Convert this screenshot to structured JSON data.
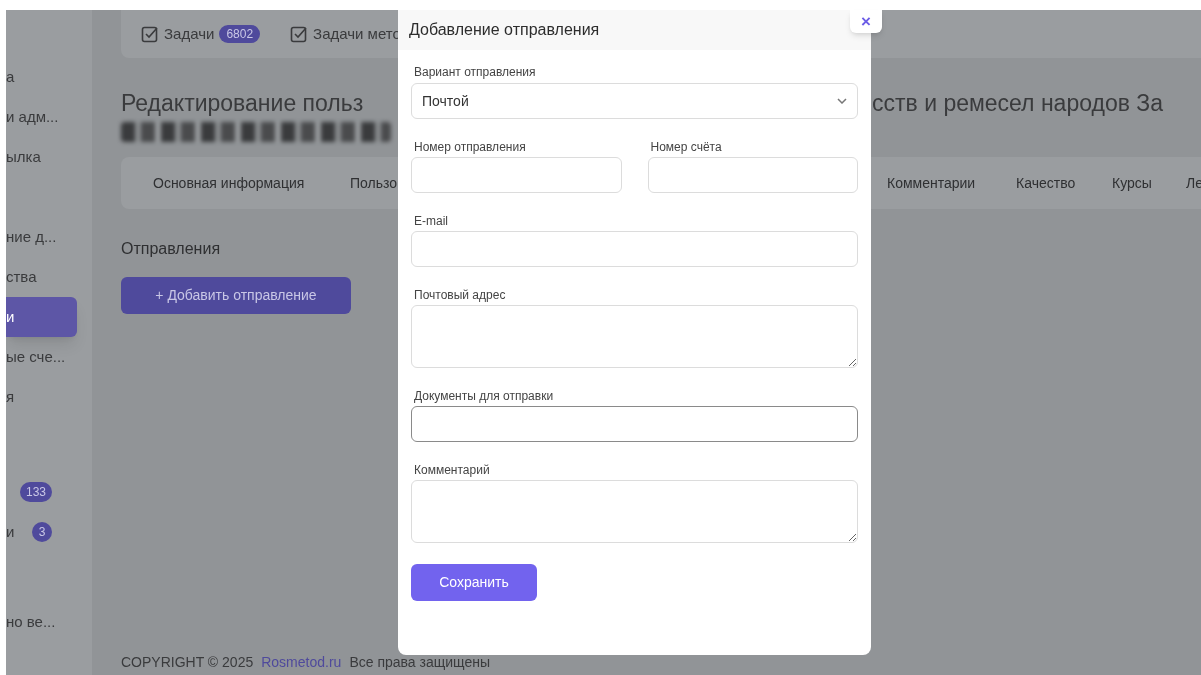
{
  "top_card": {
    "items": [
      {
        "label": "Задачи",
        "badge": "6802"
      },
      {
        "label": "Задачи мето"
      }
    ]
  },
  "sidebar": {
    "items": [
      {
        "label": "а",
        "selected": false
      },
      {
        "label": "и адм...",
        "selected": false
      },
      {
        "label": "ылка",
        "selected": false
      },
      {
        "label": "ние д...",
        "selected": false
      },
      {
        "label": "ства",
        "selected": false
      },
      {
        "label": "и",
        "selected": true
      },
      {
        "label": "ые сче...",
        "selected": false
      },
      {
        "label": "я",
        "selected": false
      },
      {
        "badge": "133",
        "selected": false
      },
      {
        "label": "и",
        "badge": "3",
        "selected": false
      },
      {
        "label": "но ве...",
        "selected": false
      }
    ]
  },
  "page": {
    "title_left": "Редактирование польз",
    "title_right": "сств и ремесел народов За",
    "title_redacted": true,
    "tabs": [
      {
        "label": "Основная информация"
      },
      {
        "label": "Пользо"
      },
      {
        "label": "Комментарии"
      },
      {
        "label": "Качество"
      },
      {
        "label": "Курсы"
      },
      {
        "label": "Ле"
      }
    ],
    "section_title": "Отправления",
    "add_button": "+ Добавить отправление"
  },
  "footer": {
    "copyright": "COPYRIGHT © 2025",
    "link": "Rosmetod.ru",
    "rights": "Все права защищены"
  },
  "modal": {
    "title": "Добавление отправления",
    "close": "×",
    "rows": [
      [
        {
          "kind": "select",
          "label": "Вариант отправления",
          "value": "Почтой",
          "focused": false
        }
      ],
      [
        {
          "kind": "input",
          "label": "Номер отправления",
          "focused": false
        },
        {
          "kind": "input",
          "label": "Номер счёта",
          "focused": false
        }
      ],
      [
        {
          "kind": "input",
          "label": "E-mail",
          "focused": false
        }
      ],
      [
        {
          "kind": "textarea",
          "label": "Почтовый адрес",
          "focused": false
        }
      ],
      [
        {
          "kind": "input",
          "label": "Документы для отправки",
          "focused": true
        }
      ],
      [
        {
          "kind": "textarea",
          "label": "Комментарий",
          "focused": false
        }
      ]
    ],
    "save_button": "Сохранить"
  }
}
